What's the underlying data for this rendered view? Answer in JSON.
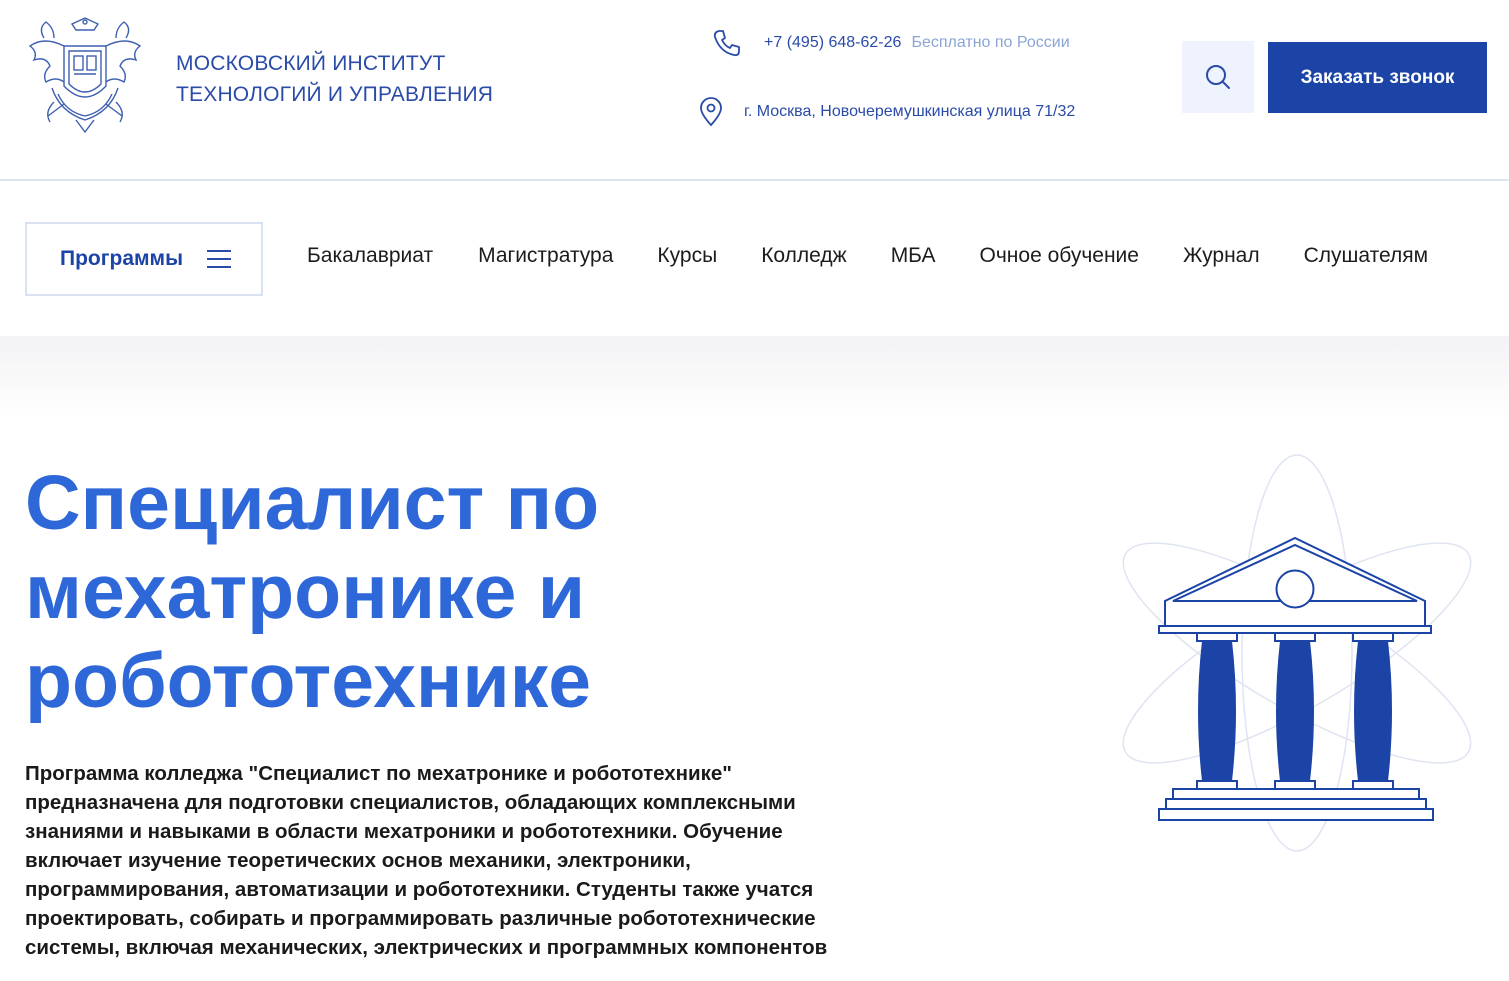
{
  "header": {
    "brand_line1": "МОСКОВСКИЙ ИНСТИТУТ",
    "brand_line2": "ТЕХНОЛОГИЙ И УПРАВЛЕНИЯ",
    "logo_icon": "institute-crest-icon",
    "phone": "+7 (495) 648-62-26",
    "phone_note": "Бесплатно по России",
    "address": "г. Москва, Новочеремушкинская улица 71/32",
    "call_button": "Заказать звонок",
    "search_icon": "search-icon"
  },
  "nav": {
    "programs_label": "Программы",
    "links": [
      "Бакалавриат",
      "Магистратура",
      "Курсы",
      "Колледж",
      "МБА",
      "Очное обучение",
      "Журнал",
      "Слушателям"
    ]
  },
  "hero": {
    "title_line1": "Специалист по",
    "title_line2": "мехатронике и",
    "title_line3": "робототехнике",
    "description_lines": [
      "Программа колледжа \"Специалист по мехатронике и робототехнике\"",
      "предназначена для подготовки специалистов, обладающих комплексными",
      "знаниями и навыками в области мехатроники и робототехники. Обучение",
      "включает изучение теоретических основ механики, электроники,",
      "программирования, автоматизации и робототехники. Студенты также учатся",
      "проектировать, собирать и программировать различные робототехнические",
      "системы, включая механических, электрических и программных компонентов"
    ],
    "illustration_icon": "university-building-icon"
  },
  "colors": {
    "brand_blue": "#1b44a6",
    "title_blue": "#2e68d8",
    "light_blue": "#8aa5d4"
  }
}
